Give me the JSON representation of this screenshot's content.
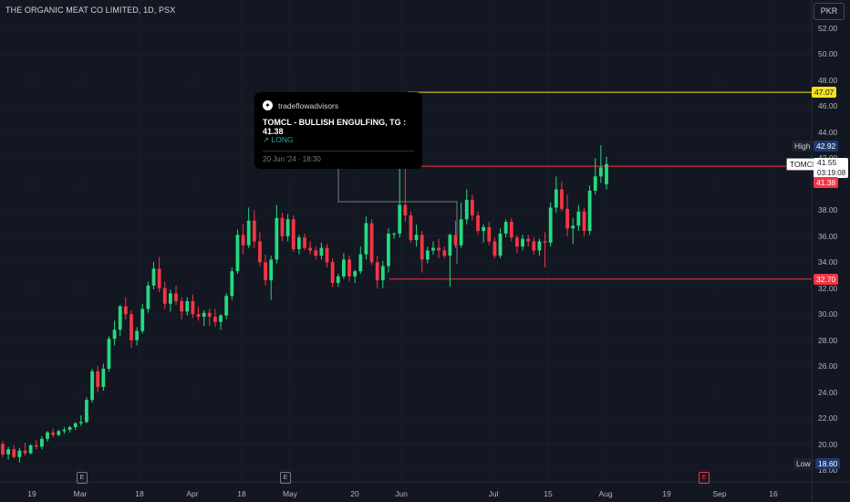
{
  "header": {
    "title": "THE ORGANIC MEAT CO LIMITED, 1D, PSX",
    "currency": "PKR"
  },
  "idea_card": {
    "author": "tradeflowadvisors",
    "headline": "TOMCL - BULLISH ENGULFING, TG : 41.38",
    "side": "↗ LONG",
    "date": "20 Jun '24 · 18:30"
  },
  "price_labels": {
    "target_line": "47.07",
    "high_label": "High",
    "high_value": "42.92",
    "symbol": "TOMCL",
    "last_price": "41.55",
    "countdown": "03:19:08",
    "target_price": "41.38",
    "support": "32.70",
    "low_label": "Low",
    "low_value": "18.60"
  },
  "events": {
    "earnings_marker": "E"
  },
  "colors": {
    "background": "#131722",
    "up": "#22ab94",
    "up_bright": "#26d97f",
    "down": "#f23645",
    "target_line": "#f5e31a",
    "grid": "#1e222d"
  },
  "chart_data": {
    "type": "candlestick",
    "title": "THE ORGANIC MEAT CO LIMITED, 1D, PSX",
    "y_ticks": [
      "52.00",
      "50.00",
      "48.00",
      "46.00",
      "44.00",
      "42.00",
      "40.00",
      "38.00",
      "36.00",
      "34.00",
      "32.00",
      "30.00",
      "28.00",
      "26.00",
      "24.00",
      "22.00",
      "20.00",
      "18.00"
    ],
    "x_ticks": [
      "19",
      "Mar",
      "18",
      "Apr",
      "18",
      "May",
      "20",
      "Jun",
      "Jul",
      "15",
      "Aug",
      "19",
      "Sep",
      "16"
    ],
    "ylim": [
      17.5,
      53.5
    ],
    "horizontal_lines": [
      {
        "price": 47.07,
        "color": "#f5e31a"
      },
      {
        "price": 41.38,
        "color": "#f23645"
      },
      {
        "price": 32.7,
        "color": "#f23645"
      }
    ],
    "candles": [
      [
        20.0,
        20.2,
        19.0,
        19.2
      ],
      [
        19.2,
        19.8,
        18.8,
        19.6
      ],
      [
        19.6,
        19.9,
        18.9,
        19.0
      ],
      [
        19.0,
        19.7,
        18.6,
        19.5
      ],
      [
        19.5,
        20.1,
        19.1,
        19.3
      ],
      [
        19.3,
        20.0,
        19.2,
        19.9
      ],
      [
        19.9,
        20.3,
        19.6,
        19.8
      ],
      [
        19.8,
        20.6,
        19.6,
        20.4
      ],
      [
        20.4,
        21.0,
        20.2,
        20.9
      ],
      [
        20.9,
        21.2,
        20.5,
        20.7
      ],
      [
        20.7,
        21.1,
        20.6,
        21.0
      ],
      [
        21.0,
        21.3,
        20.8,
        21.1
      ],
      [
        21.1,
        21.4,
        20.9,
        21.3
      ],
      [
        21.3,
        21.7,
        21.1,
        21.6
      ],
      [
        21.6,
        22.2,
        21.4,
        21.7
      ],
      [
        21.7,
        23.6,
        21.6,
        23.4
      ],
      [
        23.4,
        25.8,
        23.2,
        25.6
      ],
      [
        25.6,
        26.0,
        24.0,
        24.4
      ],
      [
        24.4,
        26.2,
        24.1,
        25.8
      ],
      [
        25.8,
        28.3,
        25.6,
        28.1
      ],
      [
        28.1,
        29.5,
        27.6,
        28.8
      ],
      [
        28.8,
        30.7,
        28.3,
        30.6
      ],
      [
        30.6,
        31.3,
        29.6,
        30.0
      ],
      [
        30.0,
        30.3,
        27.4,
        28.0
      ],
      [
        28.0,
        29.0,
        27.6,
        28.7
      ],
      [
        28.7,
        30.8,
        28.5,
        30.4
      ],
      [
        30.4,
        32.5,
        30.1,
        32.2
      ],
      [
        32.2,
        34.0,
        31.9,
        33.5
      ],
      [
        33.5,
        34.4,
        31.7,
        32.0
      ],
      [
        32.0,
        32.5,
        30.4,
        30.8
      ],
      [
        30.8,
        31.9,
        30.2,
        31.6
      ],
      [
        31.6,
        32.2,
        30.7,
        31.0
      ],
      [
        31.0,
        31.3,
        29.6,
        30.2
      ],
      [
        30.2,
        31.3,
        29.9,
        31.0
      ],
      [
        31.0,
        31.5,
        29.7,
        30.0
      ],
      [
        30.0,
        30.6,
        29.5,
        29.8
      ],
      [
        29.8,
        30.3,
        29.1,
        30.1
      ],
      [
        30.1,
        30.4,
        29.1,
        29.8
      ],
      [
        29.8,
        30.4,
        29.0,
        29.4
      ],
      [
        29.4,
        30.0,
        28.8,
        29.9
      ],
      [
        29.9,
        31.6,
        29.6,
        31.4
      ],
      [
        31.4,
        33.6,
        31.1,
        33.3
      ],
      [
        33.3,
        36.5,
        33.1,
        36.1
      ],
      [
        36.1,
        36.9,
        34.6,
        35.3
      ],
      [
        35.3,
        38.2,
        35.1,
        37.2
      ],
      [
        37.2,
        38.0,
        35.1,
        35.6
      ],
      [
        35.6,
        36.3,
        33.7,
        34.0
      ],
      [
        34.0,
        34.6,
        32.2,
        32.6
      ],
      [
        32.6,
        34.5,
        31.1,
        34.2
      ],
      [
        34.2,
        38.4,
        33.9,
        37.4
      ],
      [
        37.4,
        37.8,
        35.6,
        36.0
      ],
      [
        36.0,
        37.7,
        35.6,
        37.3
      ],
      [
        37.3,
        37.6,
        34.8,
        35.0
      ],
      [
        35.0,
        36.1,
        34.6,
        35.9
      ],
      [
        35.9,
        36.2,
        34.9,
        35.1
      ],
      [
        35.1,
        35.6,
        34.6,
        34.9
      ],
      [
        34.9,
        35.2,
        34.2,
        34.5
      ],
      [
        34.5,
        35.5,
        34.2,
        35.1
      ],
      [
        35.1,
        35.4,
        33.6,
        34.0
      ],
      [
        34.0,
        34.3,
        32.1,
        32.4
      ],
      [
        32.4,
        33.1,
        32.1,
        32.9
      ],
      [
        32.9,
        34.7,
        32.7,
        34.2
      ],
      [
        34.2,
        34.5,
        32.5,
        32.9
      ],
      [
        32.9,
        33.4,
        32.4,
        33.3
      ],
      [
        33.3,
        35.2,
        33.1,
        34.6
      ],
      [
        34.6,
        37.5,
        34.2,
        37.0
      ],
      [
        37.0,
        37.3,
        33.8,
        34.0
      ],
      [
        34.0,
        34.5,
        32.0,
        32.6
      ],
      [
        32.6,
        34.1,
        32.0,
        33.7
      ],
      [
        33.7,
        36.6,
        33.2,
        36.2
      ],
      [
        36.2,
        36.3,
        35.8,
        36.2
      ],
      [
        36.2,
        41.8,
        35.9,
        38.4
      ],
      [
        38.4,
        41.9,
        37.1,
        37.6
      ],
      [
        37.6,
        37.9,
        35.5,
        35.7
      ],
      [
        35.7,
        36.9,
        35.2,
        36.1
      ],
      [
        36.1,
        36.4,
        33.2,
        34.2
      ],
      [
        34.2,
        35.2,
        33.9,
        34.9
      ],
      [
        34.9,
        35.6,
        34.6,
        35.1
      ],
      [
        35.1,
        35.8,
        34.3,
        34.9
      ],
      [
        34.9,
        35.2,
        34.3,
        34.5
      ],
      [
        34.5,
        36.2,
        32.1,
        36.1
      ],
      [
        36.1,
        37.2,
        35.1,
        35.3
      ],
      [
        35.3,
        38.6,
        35.1,
        37.3
      ],
      [
        37.3,
        39.6,
        36.9,
        38.8
      ],
      [
        38.8,
        39.2,
        37.2,
        37.6
      ],
      [
        37.6,
        37.9,
        36.1,
        36.4
      ],
      [
        36.4,
        36.9,
        35.5,
        36.7
      ],
      [
        36.7,
        37.1,
        35.3,
        35.6
      ],
      [
        35.6,
        35.9,
        34.3,
        34.5
      ],
      [
        34.5,
        36.6,
        34.3,
        36.2
      ],
      [
        36.2,
        37.3,
        35.9,
        37.1
      ],
      [
        37.1,
        37.4,
        35.6,
        35.9
      ],
      [
        35.9,
        36.1,
        34.7,
        35.2
      ],
      [
        35.2,
        36.1,
        34.9,
        35.8
      ],
      [
        35.8,
        36.1,
        35.2,
        35.6
      ],
      [
        35.6,
        35.9,
        34.6,
        34.9
      ],
      [
        34.9,
        35.8,
        34.5,
        35.6
      ],
      [
        35.6,
        36.3,
        33.6,
        35.5
      ],
      [
        35.5,
        38.6,
        35.2,
        38.2
      ],
      [
        38.2,
        40.6,
        37.8,
        39.6
      ],
      [
        39.6,
        40.2,
        37.9,
        38.1
      ],
      [
        38.1,
        39.2,
        36.0,
        36.6
      ],
      [
        36.6,
        37.4,
        35.4,
        36.8
      ],
      [
        36.8,
        38.4,
        36.4,
        37.9
      ],
      [
        37.9,
        38.2,
        36.0,
        36.4
      ],
      [
        36.4,
        39.9,
        36.1,
        39.5
      ],
      [
        39.5,
        42.0,
        39.2,
        40.6
      ],
      [
        40.6,
        43.0,
        40.1,
        41.3
      ],
      [
        40.0,
        42.1,
        39.6,
        41.55
      ]
    ]
  }
}
